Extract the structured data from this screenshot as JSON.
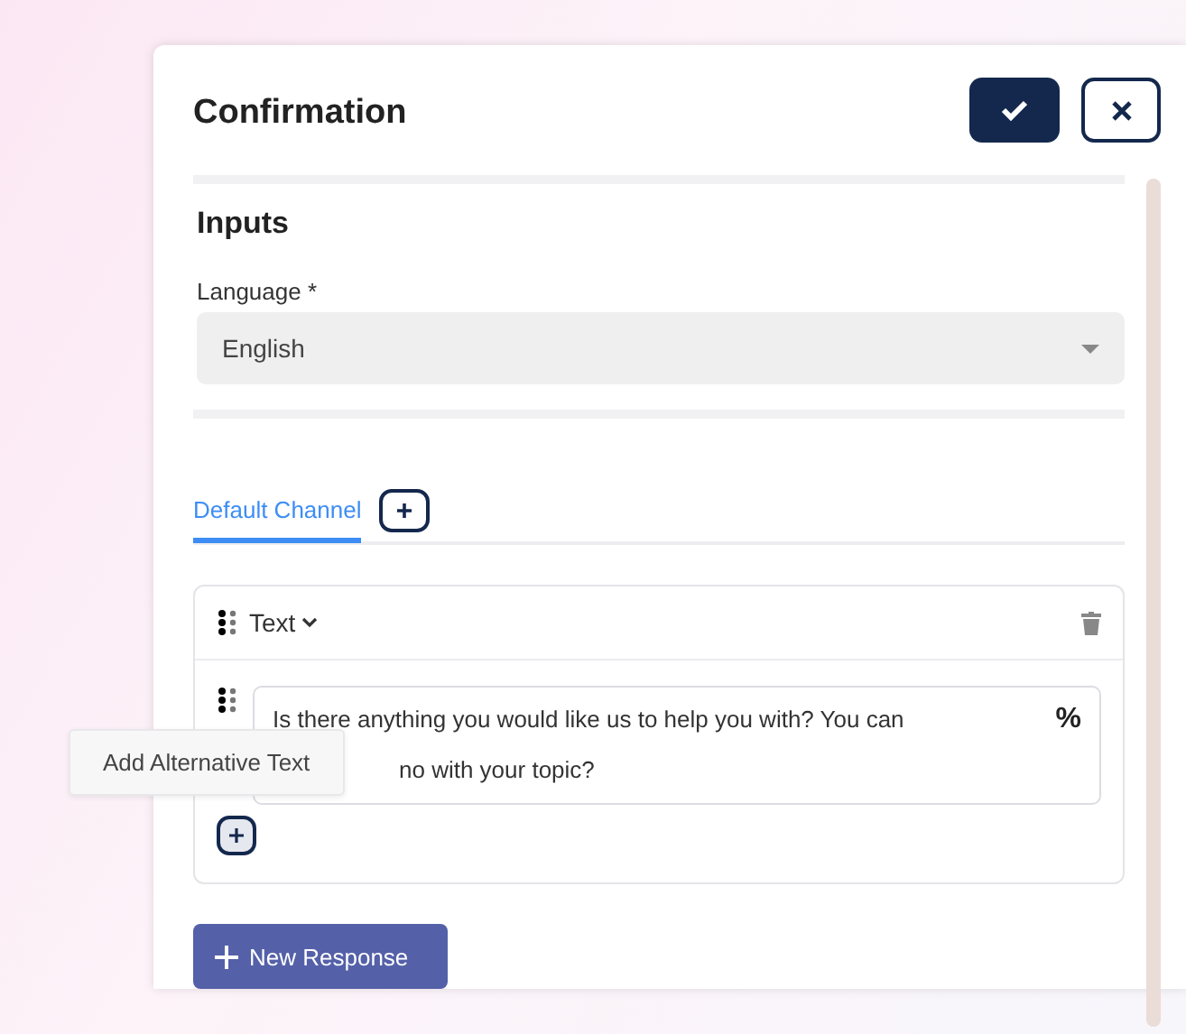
{
  "dialog": {
    "title": "Confirmation"
  },
  "inputs": {
    "title": "Inputs",
    "language": {
      "label": "Language *",
      "value": "English"
    }
  },
  "tabs": [
    {
      "label": "Default Channel",
      "selected": true
    }
  ],
  "response": {
    "type_label": "Text",
    "text_line_1": "Is there anything you would like us to help you with? You can",
    "text_line_2": "no with your topic?",
    "variable_icon": "%"
  },
  "tooltip": "Add Alternative Text",
  "new_response_button": "New Response"
}
